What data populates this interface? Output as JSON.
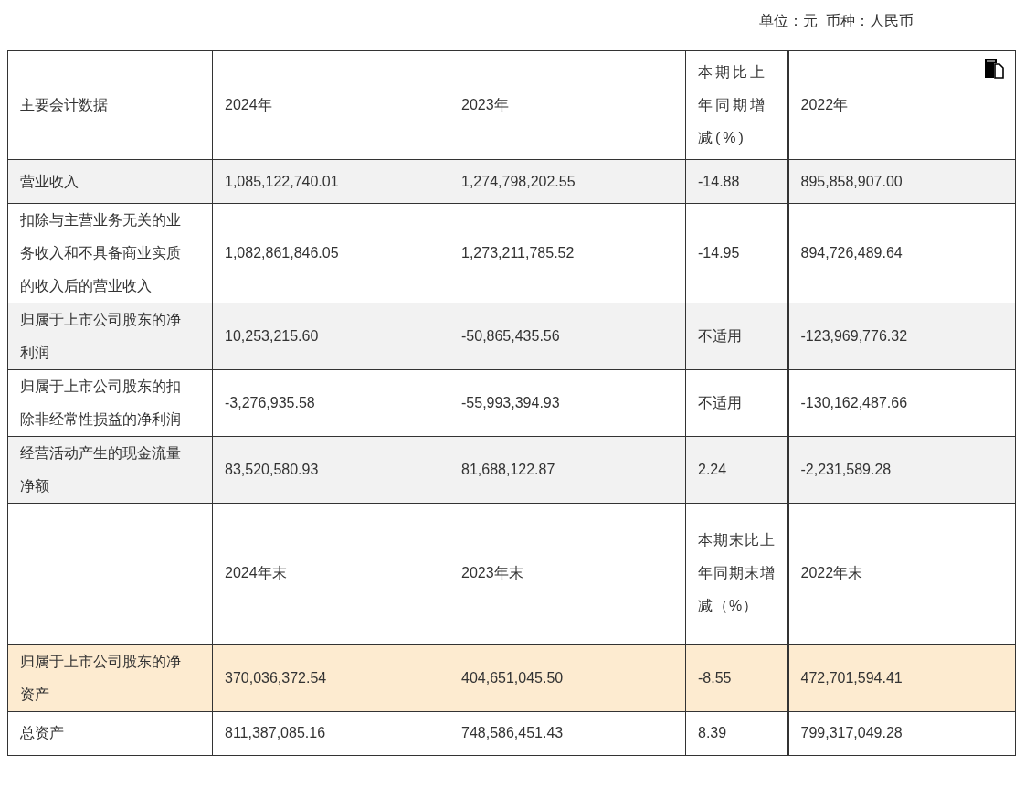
{
  "unit_note": "单位：元  币种：人民币",
  "table": {
    "rows": [
      {
        "kind": "header",
        "highlighted": false,
        "cells": [
          "主要会计数据",
          "2024年",
          "2023年",
          "本期比上年同期增减(%)",
          "2022年"
        ]
      },
      {
        "kind": "data",
        "highlighted": false,
        "cells": [
          "营业收入",
          "1,085,122,740.01",
          "1,274,798,202.55",
          "-14.88",
          "895,858,907.00"
        ]
      },
      {
        "kind": "data",
        "highlighted": false,
        "cells": [
          "扣除与主营业务无关的业务收入和不具备商业实质的收入后的营业收入",
          "1,082,861,846.05",
          "1,273,211,785.52",
          "-14.95",
          "894,726,489.64"
        ]
      },
      {
        "kind": "data",
        "highlighted": false,
        "cells": [
          "归属于上市公司股东的净利润",
          "10,253,215.60",
          "-50,865,435.56",
          "不适用",
          "-123,969,776.32"
        ]
      },
      {
        "kind": "data",
        "highlighted": false,
        "cells": [
          "归属于上市公司股东的扣除非经常性损益的净利润",
          "-3,276,935.58",
          "-55,993,394.93",
          "不适用",
          "-130,162,487.66"
        ]
      },
      {
        "kind": "data",
        "highlighted": false,
        "cells": [
          "经营活动产生的现金流量净额",
          "83,520,580.93",
          "81,688,122.87",
          "2.24",
          "-2,231,589.28"
        ]
      },
      {
        "kind": "header",
        "highlighted": false,
        "cells": [
          "",
          "2024年末",
          "2023年末",
          "本期末比上年同期末增减（%）",
          "2022年末"
        ]
      },
      {
        "kind": "data",
        "highlighted": true,
        "cells": [
          "归属于上市公司股东的净资产",
          "370,036,372.54",
          "404,651,045.50",
          "-8.55",
          "472,701,594.41"
        ]
      },
      {
        "kind": "data",
        "highlighted": false,
        "cells": [
          "总资产",
          "811,387,085.16",
          "748,586,451.43",
          "8.39",
          "799,317,049.28"
        ]
      }
    ]
  }
}
